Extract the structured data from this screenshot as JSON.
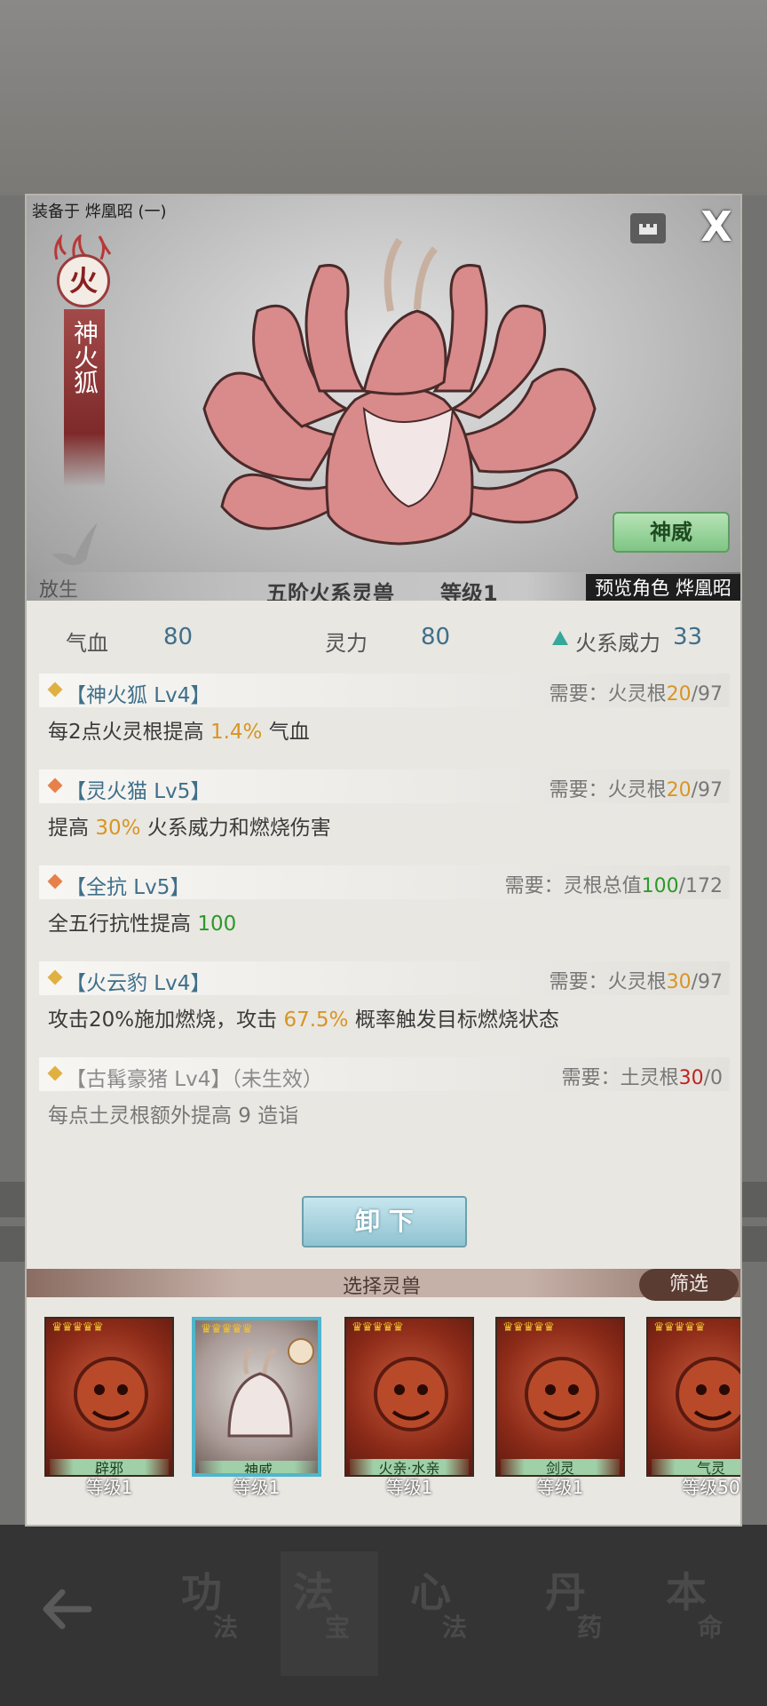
{
  "header": {
    "equipped_label": "装备于 烨凰昭 (一)",
    "close_glyph": "X"
  },
  "beast": {
    "element": "火",
    "name": "神火狐",
    "grade": "五阶火系灵兽",
    "level": "等级1",
    "preview_label": "预览角色 烨凰昭",
    "release_label": "放生",
    "shenwei_label": "神威"
  },
  "stats": {
    "hp_label": "气血",
    "hp_value": "80",
    "spirit_label": "灵力",
    "spirit_value": "80",
    "fire_label": "火系威力",
    "fire_value": "33"
  },
  "skills": [
    {
      "name": "【神火狐 Lv4】",
      "req_prefix": "需要：",
      "req_stat": "火灵根",
      "req_have": "20",
      "req_sep": "/97",
      "desc_a": "每2点火灵根提高 ",
      "desc_hl": "1.4%",
      "desc_b": " 气血",
      "diamond_color": "#e0b040"
    },
    {
      "name": "【灵火猫 Lv5】",
      "req_prefix": "需要：",
      "req_stat": "火灵根",
      "req_have": "20",
      "req_sep": "/97",
      "desc_a": "提高 ",
      "desc_hl": "30%",
      "desc_b": " 火系威力和燃烧伤害",
      "diamond_color": "#e8804a"
    },
    {
      "name": "【全抗 Lv5】",
      "req_prefix": "需要：",
      "req_stat": "灵根总值",
      "req_have": "100",
      "req_sep": "/172",
      "desc_a": "全五行抗性提高 ",
      "desc_hl": "100",
      "desc_b": "",
      "diamond_color": "#e8804a"
    },
    {
      "name": "【火云豹 Lv4】",
      "req_prefix": "需要：",
      "req_stat": "火灵根",
      "req_have": "30",
      "req_sep": "/97",
      "desc_a": "攻击20%施加燃烧，攻击 ",
      "desc_hl": "67.5%",
      "desc_b": " 概率触发目标燃烧状态",
      "diamond_color": "#e0b040"
    },
    {
      "name": "【古髯豪猪 Lv4】（未生效）",
      "req_prefix": "需要：",
      "req_stat": "土灵根",
      "req_have": "30",
      "req_sep": "/0",
      "desc_a": "每点土灵根额外提高 9 造诣",
      "desc_hl": "",
      "desc_b": "",
      "diamond_color": "#e0b040"
    }
  ],
  "unequip_label": "卸 下",
  "select_title": "选择灵兽",
  "filter_label": "筛选",
  "cards": [
    {
      "tag": "辟邪",
      "level": "等级1"
    },
    {
      "tag": "神威",
      "level": "等级1"
    },
    {
      "tag": "火亲·水亲",
      "level": "等级1"
    },
    {
      "tag": "剑灵",
      "level": "等级1"
    },
    {
      "tag": "气灵",
      "level": "等级50"
    }
  ],
  "stars": "♛♛♛♛♛",
  "bottom_nav": [
    {
      "big": "功",
      "small": "法"
    },
    {
      "big": "法",
      "small": "宝"
    },
    {
      "big": "心",
      "small": "法"
    },
    {
      "big": "丹",
      "small": "药"
    },
    {
      "big": "本",
      "small": "命"
    }
  ],
  "colors": {
    "fire_accent": "#9b3c3c",
    "value_blue": "#3f6f8a",
    "highlight_orange": "#d89522",
    "highlight_green": "#2a9a2a",
    "highlight_red": "#c02222",
    "selected_border": "#4fb6cc"
  }
}
